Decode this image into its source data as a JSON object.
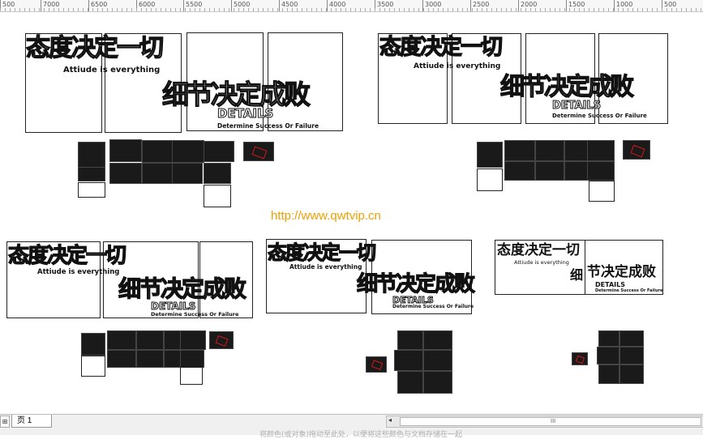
{
  "ruler": {
    "labels": [
      "500",
      "7000",
      "6500",
      "6000",
      "5500",
      "5000",
      "4500",
      "4000",
      "3500",
      "3000",
      "2500",
      "2000",
      "1500",
      "1000",
      "500"
    ]
  },
  "designs": [
    {
      "title_cn": "态度决定一切",
      "title_en": "Attiude is everything",
      "slogan_cn": "细节决定成败",
      "details_word": "DETAILS",
      "details_sub": "Determine Success Or Failure"
    },
    {
      "title_cn": "态度决定一切",
      "title_en": "Attiude is everything",
      "slogan_cn": "细节决定成败",
      "details_word": "DETAILS",
      "details_sub": "Determine Success Or Failure"
    },
    {
      "title_cn": "态度决定一切",
      "title_en": "Attiude is everything",
      "slogan_cn": "细节决定成败",
      "details_word": "DETAILS",
      "details_sub": "Determine Success Or Failure"
    },
    {
      "title_cn": "态度决定一切",
      "title_en": "Attiude is everything",
      "slogan_cn": "细节决定成败",
      "details_word": "DETAILS",
      "details_sub": "Determine Success Or Failure"
    },
    {
      "title_cn": "态度决定一切",
      "title_en": "Attiude is everything",
      "slogan_cn": "节决定成败",
      "slogan_prefix": "细",
      "details_word": "DETAILS",
      "details_sub": "Determine Success Or Failure"
    }
  ],
  "watermark_url": "http://www.qwtvip.cn",
  "tabs": {
    "page_tab": "页 1",
    "first_btn": "⊞"
  },
  "status_text": "将颜色(或对象)拖动至此处，以便将这些颜色与文档存储在一起",
  "colors": {
    "accent": "#f0a000",
    "ink": "#111111",
    "mark": "#d01818"
  }
}
